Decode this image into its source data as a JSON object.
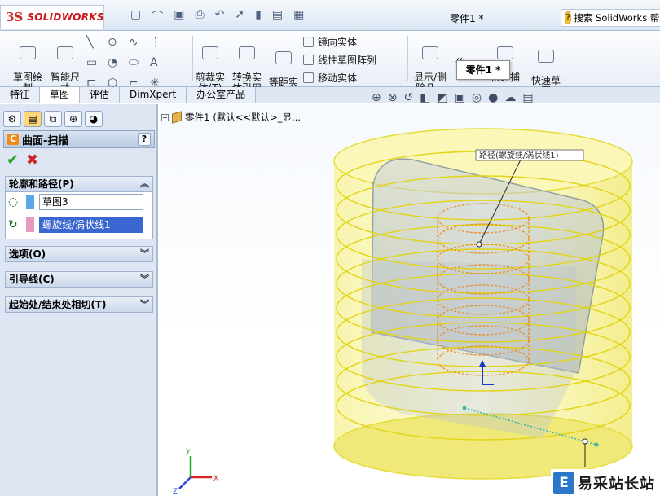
{
  "app": {
    "logo_mark": "3S",
    "logo_text": "SOLIDWORKS",
    "document_title": "零件1 *",
    "search_placeholder": "搜索 SolidWorks 帮助"
  },
  "ribbon": {
    "sketch_draw": "草图绘\n制",
    "smart_dim": "智能尺\n寸",
    "trim": "剪裁实\n体(T)",
    "convert": "转换实\n体引用",
    "offset": "等距实\n体",
    "mirror": "镜向实体",
    "linear_pattern": "线性草图阵列",
    "move": "移动实体",
    "show_delete": "显示/删\n除几...",
    "repair": "修...",
    "quick_snap": "快速捕\n...",
    "quick_sketch": "快速草\n图"
  },
  "tooltip": "零件1 *",
  "tabs": [
    "特征",
    "草图",
    "评估",
    "DimXpert",
    "办公室产品"
  ],
  "active_tab": 1,
  "tree": {
    "part_label": "零件1",
    "config_label": "(默认<<默认>_显..."
  },
  "property_manager": {
    "title": "曲面-扫描",
    "help": "?",
    "profile_path_header": "轮廓和路径(P)",
    "profile_value": "草图3",
    "path_value": "螺旋线/涡状线1",
    "options_header": "选项(O)",
    "guide_header": "引导线(C)",
    "tangency_header": "起始处/结束处相切(T)",
    "profile_color": "#5aa7e8",
    "path_color": "#e899c0"
  },
  "callout": {
    "label": "路径(螺旋线/涡状线1)"
  },
  "triad": {
    "x": "X",
    "y": "Y",
    "z": "Z"
  },
  "watermark": {
    "logo": "E",
    "text": "易采站长站"
  }
}
